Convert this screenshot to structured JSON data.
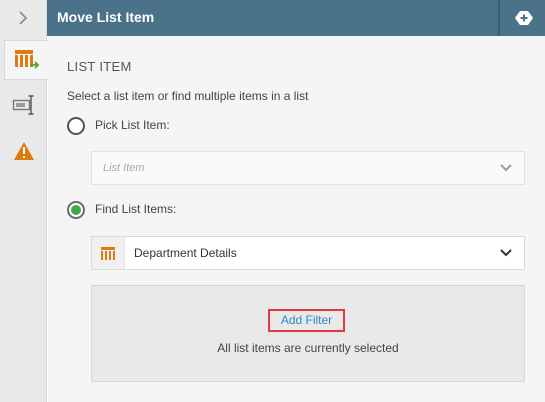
{
  "header": {
    "title": "Move List Item"
  },
  "section": {
    "title": "LIST ITEM",
    "description": "Select a list item or find multiple items in a list"
  },
  "options": {
    "pick": {
      "label": "Pick List Item:",
      "selected": false,
      "dropdown_placeholder": "List Item"
    },
    "find": {
      "label": "Find List Items:",
      "selected": true,
      "dropdown_value": "Department Details"
    }
  },
  "filter": {
    "add_label": "Add Filter",
    "status": "All list items are currently selected"
  },
  "colors": {
    "header_bg": "#4a7289",
    "accent_orange": "#e07a10",
    "radio_green": "#3ea94a",
    "link_blue": "#2e86c8",
    "highlight_red": "#e0393e"
  },
  "icons": {
    "collapse": "chevron-right-icon",
    "add": "plus-icon",
    "tab_list": "list-arrow-icon",
    "tab_properties": "text-cursor-icon",
    "tab_warning": "warning-icon",
    "dropdown_list": "list-icon"
  }
}
